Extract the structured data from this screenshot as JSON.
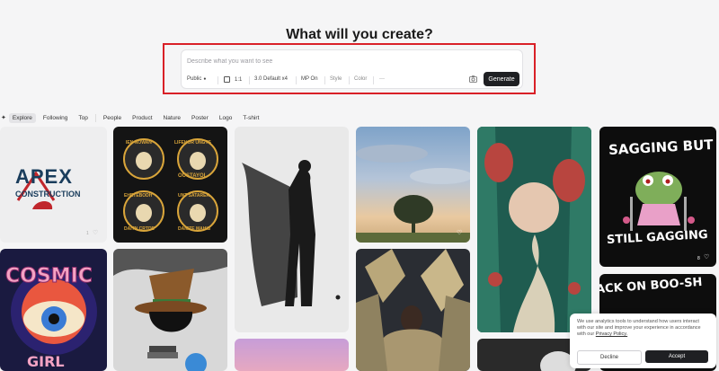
{
  "headline": "What will you create?",
  "prompt": {
    "placeholder": "Describe what you want to see",
    "value": "",
    "options": {
      "visibility": "Public",
      "aspect": "1:1",
      "model": "3.0 Default x4",
      "magic_prompt": "MP On",
      "style": "Style",
      "color": "Color",
      "more": "···"
    },
    "generate_label": "Generate"
  },
  "tabs": [
    "Explore",
    "Following",
    "Top",
    "People",
    "Product",
    "Nature",
    "Poster",
    "Logo",
    "T-shirt"
  ],
  "active_tab": "Explore",
  "gallery": {
    "apex": {
      "line1": "APEX",
      "line2": "CONSTRUCTION",
      "likes": "1"
    },
    "skulls": {
      "t1": "IEN NOWAN",
      "t2": "LIFEHOR UNGTS",
      "t3": "OUSTAYOL",
      "t4": "EHETEBODH",
      "t5": "UNT SATARER",
      "t6": "DAITN CRTDE",
      "t7": "DAICTE MAHIS"
    },
    "frog": {
      "top": "SAGGING BUT",
      "bottom": "STILL GAGGING",
      "likes": "8"
    },
    "boo": {
      "text": "ACK ON BOO-SH"
    },
    "cosmic": {
      "top": "COSMIC",
      "bottom": "GIRL"
    }
  },
  "cookie": {
    "text": "We use analytics tools to understand how users interact with our site and improve your experience in accordance with our",
    "link": "Privacy Policy.",
    "decline": "Decline",
    "accept": "Accept"
  },
  "colors": {
    "highlight": "#d92027",
    "button": "#1f2023",
    "background": "#f5f5f6"
  }
}
